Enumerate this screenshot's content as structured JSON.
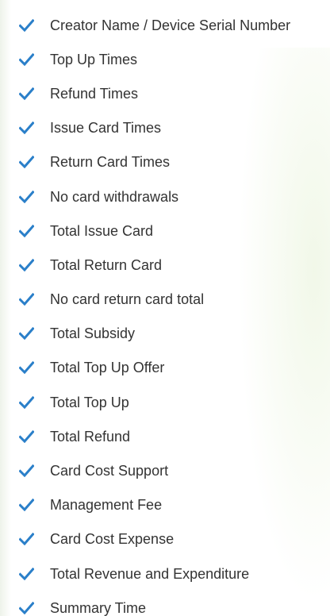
{
  "colors": {
    "check": "#2a7fc9",
    "text": "#333333"
  },
  "checkbox_icon": "checkmark-icon",
  "items": [
    {
      "label": "Creator Name / Device Serial Number",
      "checked": true
    },
    {
      "label": "Top Up Times",
      "checked": true
    },
    {
      "label": "Refund Times",
      "checked": true
    },
    {
      "label": "Issue Card Times",
      "checked": true
    },
    {
      "label": "Return Card Times",
      "checked": true
    },
    {
      "label": "No card withdrawals",
      "checked": true
    },
    {
      "label": "Total Issue Card",
      "checked": true
    },
    {
      "label": "Total Return Card",
      "checked": true
    },
    {
      "label": "No card return card total",
      "checked": true
    },
    {
      "label": "Total Subsidy",
      "checked": true
    },
    {
      "label": "Total Top Up Offer",
      "checked": true
    },
    {
      "label": "Total Top Up",
      "checked": true
    },
    {
      "label": "Total Refund",
      "checked": true
    },
    {
      "label": "Card Cost Support",
      "checked": true
    },
    {
      "label": "Management Fee",
      "checked": true
    },
    {
      "label": "Card Cost Expense",
      "checked": true
    },
    {
      "label": "Total Revenue and Expenditure",
      "checked": true
    },
    {
      "label": "Summary Time",
      "checked": true
    }
  ]
}
